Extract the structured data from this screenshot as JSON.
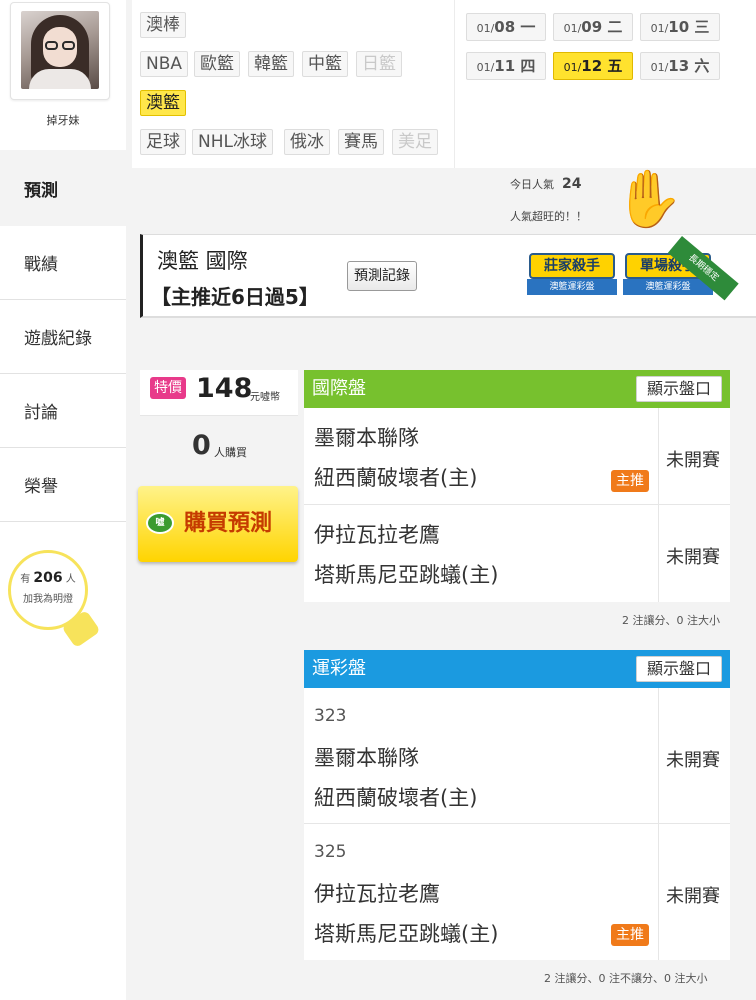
{
  "profile": {
    "username": "掉牙妹"
  },
  "nav": {
    "predict": "預測",
    "record": "戰績",
    "game_log": "遊戲紀錄",
    "discuss": "討論",
    "honor": "榮譽"
  },
  "bulb": {
    "prefix": "有",
    "count": "206",
    "suffix": "人",
    "text": "加我為明燈"
  },
  "sports": [
    {
      "label": "澳棒",
      "state": "normal"
    },
    {
      "label": "NBA",
      "state": "normal"
    },
    {
      "label": "歐籃",
      "state": "normal"
    },
    {
      "label": "韓籃",
      "state": "normal"
    },
    {
      "label": "中籃",
      "state": "normal"
    },
    {
      "label": "日籃",
      "state": "disabled"
    },
    {
      "label": "澳籃",
      "state": "active"
    },
    {
      "label": "足球",
      "state": "normal"
    },
    {
      "label": "NHL冰球",
      "state": "normal"
    },
    {
      "label": "俄冰",
      "state": "normal"
    },
    {
      "label": "賽馬",
      "state": "normal"
    },
    {
      "label": "美足",
      "state": "disabled"
    }
  ],
  "dates": [
    {
      "md": "01/08",
      "day": "一"
    },
    {
      "md": "01/09",
      "day": "二"
    },
    {
      "md": "01/10",
      "day": "三"
    },
    {
      "md": "01/11",
      "day": "四"
    },
    {
      "md": "01/12",
      "day": "五",
      "active": true
    },
    {
      "md": "01/13",
      "day": "六"
    }
  ],
  "popularity": {
    "label": "今日人氣",
    "value": "24",
    "note": "人氣超旺的！！"
  },
  "header": {
    "title": "澳籃 國際",
    "subtitle": "【主推近6日過5】",
    "record_button": "預測記錄",
    "badges": [
      {
        "title": "莊家殺手",
        "sub": "澳籃運彩盤"
      },
      {
        "title": "單場殺手",
        "sub": "澳籃運彩盤"
      }
    ],
    "ribbon": "長期穩定"
  },
  "purchase": {
    "special_label": "特價",
    "price": "148",
    "price_unit": "元噓幣",
    "buyers": "0",
    "buyers_unit": "人購買",
    "buy_button": "購買預測",
    "coin_label": "噓"
  },
  "international": {
    "title": "國際盤",
    "show_button": "顯示盤口",
    "games": [
      {
        "away": "墨爾本聯隊",
        "home": "紐西蘭破壞者(主)",
        "status": "未開賽",
        "pick": "主推"
      },
      {
        "away": "伊拉瓦拉老鷹",
        "home": "塔斯馬尼亞跳蟻(主)",
        "status": "未開賽"
      }
    ],
    "footnote": "2 注讓分、0 注大小"
  },
  "sports_lottery": {
    "title": "運彩盤",
    "show_button": "顯示盤口",
    "games": [
      {
        "num": "323",
        "away": "墨爾本聯隊",
        "home": "紐西蘭破壞者(主)",
        "status": "未開賽"
      },
      {
        "num": "325",
        "away": "伊拉瓦拉老鷹",
        "home": "塔斯馬尼亞跳蟻(主)",
        "status": "未開賽",
        "pick": "主推"
      }
    ],
    "footnote": "2 注讓分、0 注不讓分、0 注大小"
  },
  "colors": {
    "international_header": "#77c12e",
    "lottery_header": "#1b9ae0",
    "active_tag": "#ffe74a",
    "pick_badge": "#f07a1a",
    "special_badge": "#e83a8a"
  }
}
